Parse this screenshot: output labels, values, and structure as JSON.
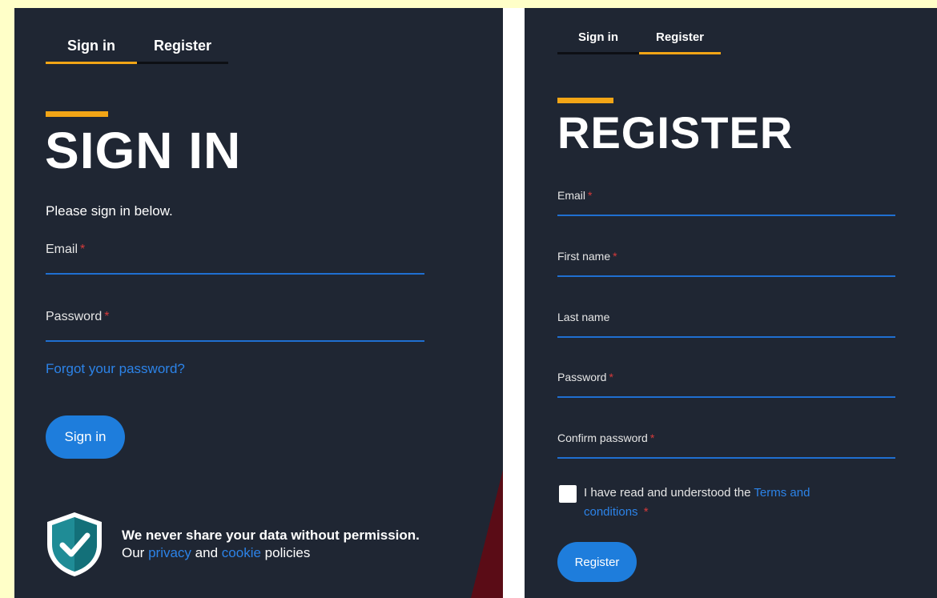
{
  "signin_panel": {
    "tabs": [
      {
        "label": "Sign in",
        "active": true
      },
      {
        "label": "Register",
        "active": false
      }
    ],
    "heading": "SIGN IN",
    "subtitle": "Please sign in below.",
    "fields": [
      {
        "label": "Email",
        "required_mark": "*",
        "value": ""
      },
      {
        "label": "Password",
        "required_mark": "*",
        "value": ""
      }
    ],
    "forgot_link": "Forgot your password?",
    "button_label": "Sign in",
    "privacy": {
      "headline": "We never share your data without permission.",
      "line_prefix": "Our",
      "privacy_link": "privacy",
      "and": "and",
      "cookie_link": "cookie",
      "line_suffix": "policies",
      "icon": "shield-check-icon"
    }
  },
  "register_panel": {
    "tabs": [
      {
        "label": "Sign in",
        "active": false
      },
      {
        "label": "Register",
        "active": true
      }
    ],
    "heading": "REGISTER",
    "fields": [
      {
        "label": "Email",
        "required_mark": "*",
        "value": ""
      },
      {
        "label": "First name",
        "required_mark": "*",
        "value": ""
      },
      {
        "label": "Last name",
        "required_mark": "",
        "value": ""
      },
      {
        "label": "Password",
        "required_mark": "*",
        "value": ""
      },
      {
        "label": "Confirm password",
        "required_mark": "*",
        "value": ""
      }
    ],
    "terms": {
      "text": "I have read and understood the",
      "link": "Terms and conditions",
      "required_mark": "*",
      "checked": false
    },
    "button_label": "Register"
  },
  "colors": {
    "panel_bg": "#1f2633",
    "accent": "#f2a516",
    "link": "#2c83e8",
    "button": "#1e7ddc",
    "required": "#d63a3a",
    "page_bg": "#ffffc8"
  }
}
